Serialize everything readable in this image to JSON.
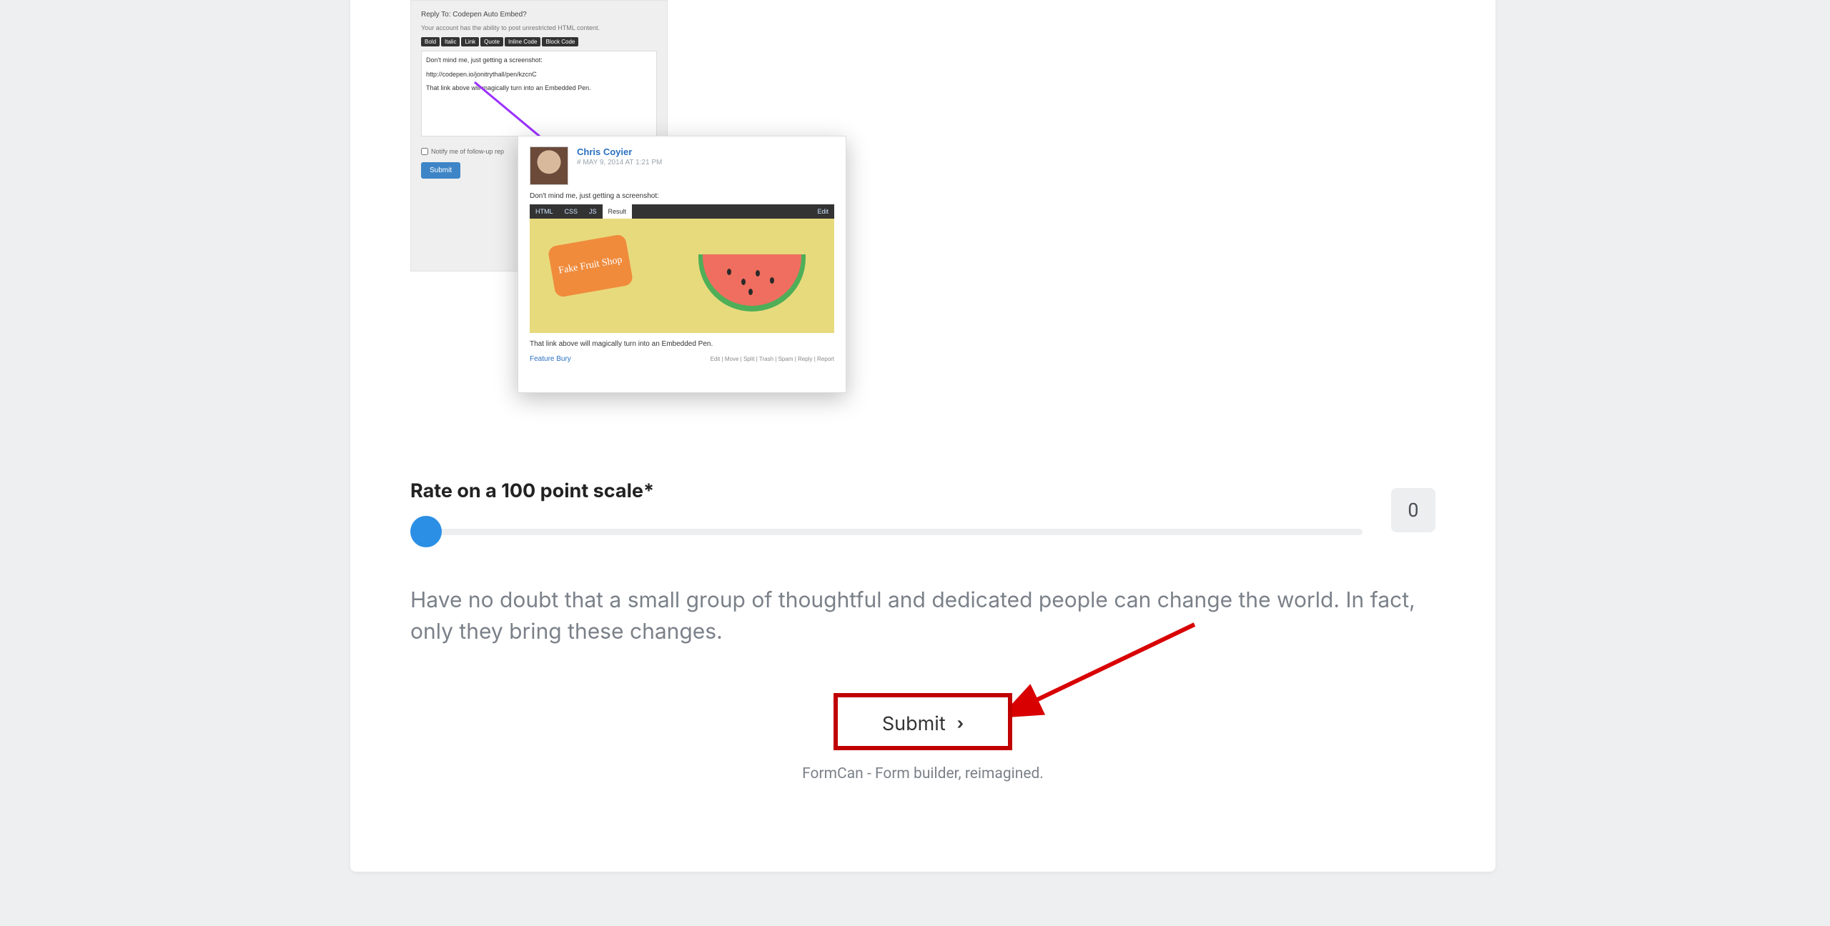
{
  "embedded": {
    "reply_title": "Reply To: Codepen Auto Embed?",
    "account_note": "Your account has the ability to post unrestricted HTML content.",
    "toolbar": [
      "Bold",
      "Italic",
      "Link",
      "Quote",
      "Inline Code",
      "Block Code"
    ],
    "editor_line1": "Don't mind me, just getting a screenshot:",
    "editor_line2": "http://codepen.io/jonitrythall/pen/kzcnC",
    "editor_line3": "That link above will magically turn into an Embedded Pen.",
    "notify_label": "Notify me of follow-up rep",
    "submit_label": "Submit",
    "comment": {
      "author": "Chris Coyier",
      "meta": "# MAY 9, 2014 AT 1:21 PM",
      "body": "Don't mind me, just getting a screenshot:",
      "tabs": [
        "HTML",
        "CSS",
        "JS",
        "Result"
      ],
      "edit": "Edit",
      "tag_text": "Fake Fruit Shop",
      "tail": "That link above will magically turn into an Embedded Pen.",
      "feature": "Feature Bury",
      "modlinks": "Edit | Move | Split | Trash | Spam | Reply | Report"
    }
  },
  "rate": {
    "label": "Rate on a 100 point scale*",
    "value": "0"
  },
  "quote": "Have no doubt that a small group of thoughtful and dedicated people can change the world. In fact, only they bring these changes.",
  "submit_label": "Submit",
  "footer": "FormCan - Form builder, reimagined."
}
